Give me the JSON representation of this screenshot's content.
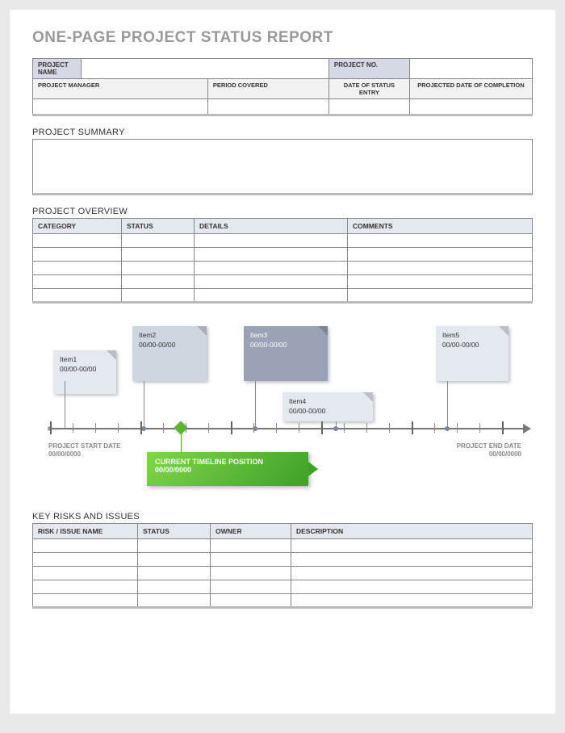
{
  "title": "ONE-PAGE PROJECT STATUS REPORT",
  "info": {
    "projectName": "PROJECT NAME",
    "projectNo": "PROJECT NO.",
    "projectManager": "PROJECT MANAGER",
    "periodCovered": "PERIOD COVERED",
    "dateStatusEntry": "DATE OF STATUS ENTRY",
    "projectedCompletion": "PROJECTED DATE OF COMPLETION"
  },
  "sections": {
    "summary": "PROJECT SUMMARY",
    "overview": "PROJECT OVERVIEW",
    "risks": "KEY RISKS AND ISSUES"
  },
  "overviewCols": [
    "CATEGORY",
    "STATUS",
    "DETAILS",
    "COMMENTS"
  ],
  "risksCols": [
    "RISK / ISSUE NAME",
    "STATUS",
    "OWNER",
    "DESCRIPTION"
  ],
  "timeline": {
    "start": {
      "label": "PROJECT START DATE",
      "date": "00/00/0000"
    },
    "end": {
      "label": "PROJECT END DATE",
      "date": "00/00/0000"
    },
    "current": {
      "label": "CURRENT TIMELINE POSITION",
      "date": "00/00/0000"
    },
    "items": [
      {
        "name": "Item1",
        "date": "00/00-00/00"
      },
      {
        "name": "Item2",
        "date": "00/00-00/00"
      },
      {
        "name": "Item3",
        "date": "00/00-00/00"
      },
      {
        "name": "Item4",
        "date": "00/00-00/00"
      },
      {
        "name": "Item5",
        "date": "00/00-00/00"
      }
    ]
  }
}
